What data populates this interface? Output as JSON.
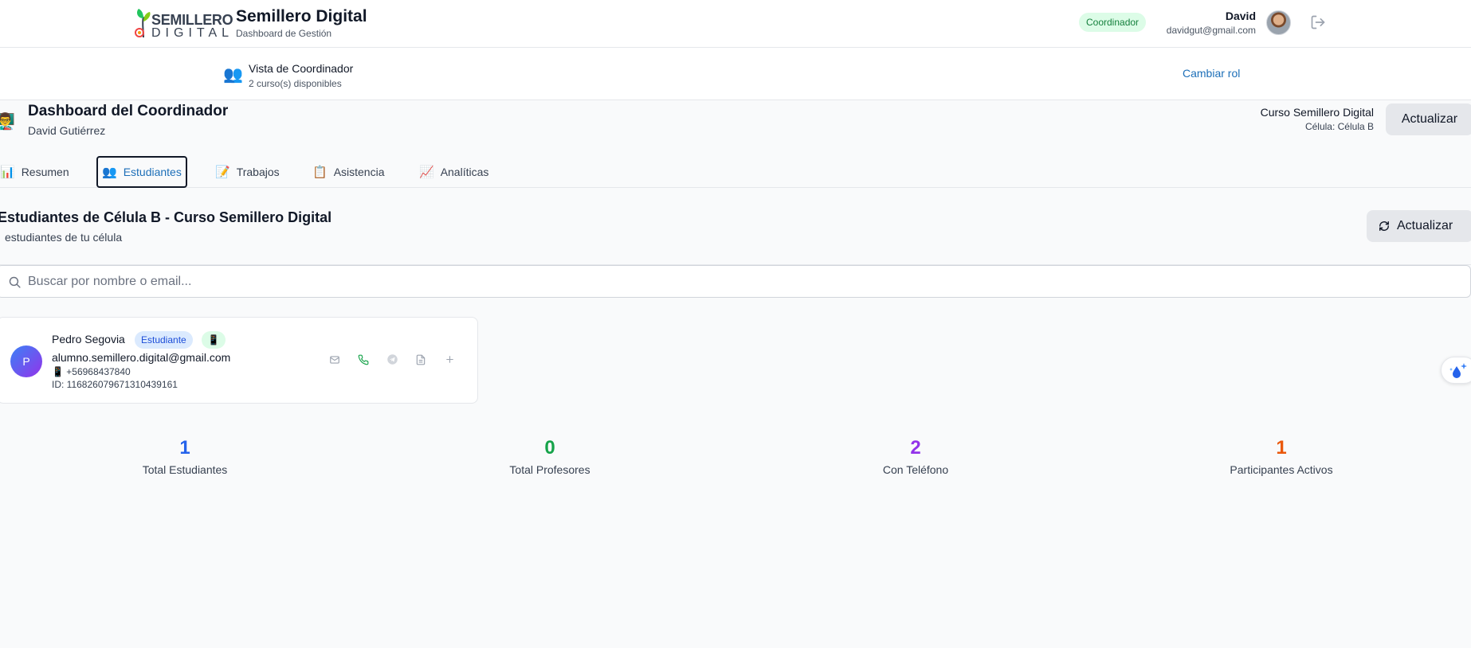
{
  "header": {
    "logo_top": "SEMILLERO",
    "logo_bottom": "DIGITAL",
    "title": "Semillero Digital",
    "subtitle": "Dashboard de Gestión",
    "role_badge": "Coordinador",
    "user_name": "David",
    "user_email": "davidgut@gmail.com"
  },
  "role_bar": {
    "icon": "👥",
    "title": "Vista de Coordinador",
    "subtitle": "2 curso(s) disponibles",
    "change_role_label": "Cambiar rol"
  },
  "dashboard": {
    "emoji": "👨‍🏫",
    "title": "Dashboard del Coordinador",
    "user": "David Gutiérrez",
    "course_name": "Curso Semillero Digital",
    "cell_label": "Célula: Célula B",
    "refresh_label": "Actualizar"
  },
  "tabs": [
    {
      "icon": "📊",
      "label": "Resumen",
      "active": false
    },
    {
      "icon": "👥",
      "label": "Estudiantes",
      "active": true
    },
    {
      "icon": "📝",
      "label": "Trabajos",
      "active": false
    },
    {
      "icon": "📋",
      "label": "Asistencia",
      "active": false
    },
    {
      "icon": "📈",
      "label": "Analíticas",
      "active": false
    }
  ],
  "students_section": {
    "title": "Estudiantes de Célula B - Curso Semillero Digital",
    "subtitle": "estudiantes de tu célula",
    "refresh_label": "Actualizar",
    "search_placeholder": "Buscar por nombre o email..."
  },
  "students": [
    {
      "initial": "P",
      "name": "Pedro Segovia",
      "role_badge": "Estudiante",
      "phone_badge": "📱",
      "email": "alumno.semillero.digital@gmail.com",
      "phone": "📱 +56968437840",
      "id": "ID: 116826079671310439161",
      "actions": [
        "mail-icon",
        "phone-icon",
        "telegram-icon",
        "document-icon",
        "plus-icon"
      ]
    }
  ],
  "stats": [
    {
      "value": "1",
      "label": "Total Estudiantes",
      "color": "#2563eb"
    },
    {
      "value": "0",
      "label": "Total Profesores",
      "color": "#16a34a"
    },
    {
      "value": "2",
      "label": "Con Teléfono",
      "color": "#9333ea"
    },
    {
      "value": "1",
      "label": "Participantes Activos",
      "color": "#ea580c"
    }
  ],
  "colors": {
    "primary_link": "#1d6fb8",
    "badge_green_bg": "#dcfce7",
    "badge_blue_bg": "#dbeafe"
  }
}
